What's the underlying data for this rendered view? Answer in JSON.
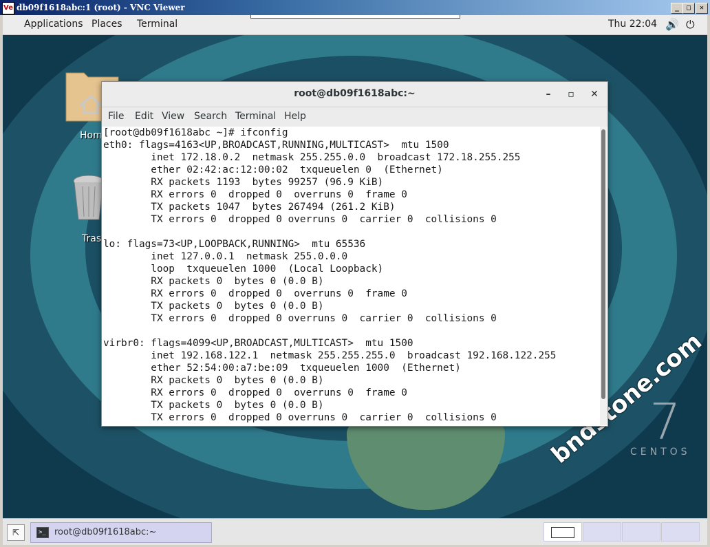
{
  "vnc": {
    "title": "db09f1618abc:1 (root) - VNC Viewer",
    "icon": "Ve",
    "buttons": {
      "minimize": "_",
      "maximize": "□",
      "close": "✕"
    }
  },
  "topbar": {
    "applications": "Applications",
    "places": "Places",
    "terminal": "Terminal",
    "clock": "Thu 22:04",
    "volume_icon": "🔊",
    "power_icon": "⏻"
  },
  "desktop": {
    "icons": [
      {
        "label": "Hom",
        "icon": "home-folder-icon"
      },
      {
        "label": "Tras",
        "icon": "trash-icon"
      }
    ],
    "centos_number": "7",
    "centos_label": "CENTOS",
    "watermark": "bndstone.com"
  },
  "terminal": {
    "title": "root@db09f1618abc:~",
    "window_buttons": {
      "minimize": "–",
      "maximize": "▫",
      "close": "✕"
    },
    "menu": [
      "File",
      "Edit",
      "View",
      "Search",
      "Terminal",
      "Help"
    ],
    "lines": [
      "[root@db09f1618abc ~]# ifconfig",
      "eth0: flags=4163<UP,BROADCAST,RUNNING,MULTICAST>  mtu 1500",
      "        inet 172.18.0.2  netmask 255.255.0.0  broadcast 172.18.255.255",
      "        ether 02:42:ac:12:00:02  txqueuelen 0  (Ethernet)",
      "        RX packets 1193  bytes 99257 (96.9 KiB)",
      "        RX errors 0  dropped 0  overruns 0  frame 0",
      "        TX packets 1047  bytes 267494 (261.2 KiB)",
      "        TX errors 0  dropped 0 overruns 0  carrier 0  collisions 0",
      "",
      "lo: flags=73<UP,LOOPBACK,RUNNING>  mtu 65536",
      "        inet 127.0.0.1  netmask 255.0.0.0",
      "        loop  txqueuelen 1000  (Local Loopback)",
      "        RX packets 0  bytes 0 (0.0 B)",
      "        RX errors 0  dropped 0  overruns 0  frame 0",
      "        TX packets 0  bytes 0 (0.0 B)",
      "        TX errors 0  dropped 0 overruns 0  carrier 0  collisions 0",
      "",
      "virbr0: flags=4099<UP,BROADCAST,MULTICAST>  mtu 1500",
      "        inet 192.168.122.1  netmask 255.255.255.0  broadcast 192.168.122.255",
      "        ether 52:54:00:a7:be:09  txqueuelen 1000  (Ethernet)",
      "        RX packets 0  bytes 0 (0.0 B)",
      "        RX errors 0  dropped 0  overruns 0  frame 0",
      "        TX packets 0  bytes 0 (0.0 B)",
      "        TX errors 0  dropped 0 overruns 0  carrier 0  collisions 0"
    ]
  },
  "taskbar": {
    "show_desktop_icon": "⇱",
    "task_label": "root@db09f1618abc:~",
    "task_icon": ">_",
    "workspaces": 4
  },
  "colors": {
    "desktop_bg": "#0f3a4d",
    "accent": "#0a246a"
  }
}
